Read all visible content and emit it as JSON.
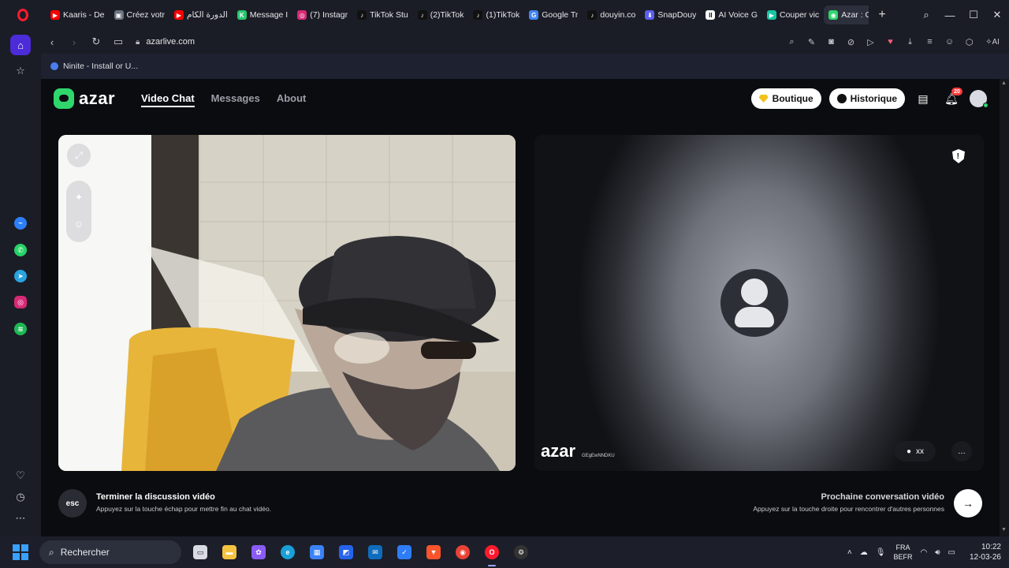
{
  "browser": {
    "tabs": [
      {
        "label": "Kaaris - De",
        "fav_color": "#ff0000",
        "fav": "▶",
        "active": false
      },
      {
        "label": "Créez votr",
        "fav_color": "#6b7280",
        "fav": "▣",
        "active": false
      },
      {
        "label": "الدورة الكام",
        "fav_color": "#ff0000",
        "fav": "▶",
        "active": false
      },
      {
        "label": "Message I",
        "fav_color": "#28c76f",
        "fav": "K",
        "active": false
      },
      {
        "label": "(7) Instagr",
        "fav_color": "#d62976",
        "fav": "◎",
        "active": false
      },
      {
        "label": "TikTok Stu",
        "fav_color": "#111111",
        "fav": "♪",
        "active": false
      },
      {
        "label": "(2)TikTok",
        "fav_color": "#111111",
        "fav": "♪",
        "active": false
      },
      {
        "label": "(1)TikTok",
        "fav_color": "#111111",
        "fav": "♪",
        "active": false
      },
      {
        "label": "Google Tr",
        "fav_color": "#4285f4",
        "fav": "G",
        "active": false
      },
      {
        "label": "douyin.co",
        "fav_color": "#111111",
        "fav": "♪",
        "active": false
      },
      {
        "label": "SnapDouy",
        "fav_color": "#5b5ff0",
        "fav": "⬇",
        "active": false
      },
      {
        "label": "AI Voice G",
        "fav_color": "#ffffff",
        "fav": "II",
        "active": false
      },
      {
        "label": "Couper vic",
        "fav_color": "#16c6a4",
        "fav": "▶",
        "active": false
      },
      {
        "label": "Azar : Chat Vid",
        "fav_color": "#2fd66c",
        "fav": "◉",
        "active": true
      }
    ],
    "new_tab": "+",
    "url": "azarlive.com",
    "bookmark": "Ninite - Install or U..."
  },
  "site": {
    "logo": "azar",
    "nav": [
      "Video Chat",
      "Messages",
      "About"
    ],
    "boutique": "Boutique",
    "historique": "Historique",
    "notif_count": "20"
  },
  "partner": {
    "watermark": "azar",
    "watermark_id": "GEgEwNNDKU",
    "status": "xx"
  },
  "footer": {
    "esc_key": "esc",
    "end_title": "Terminer la discussion vidéo",
    "end_sub": "Appuyez sur la touche échap pour mettre fin au chat vidéo.",
    "next_title": "Prochaine conversation vidéo",
    "next_sub": "Appuyez sur la touche droite pour rencontrer d'autres personnes"
  },
  "taskbar": {
    "search": "Rechercher",
    "lang_top": "FRA",
    "lang_bottom": "BEFR",
    "time": "10:22",
    "date": "12-03-26"
  }
}
